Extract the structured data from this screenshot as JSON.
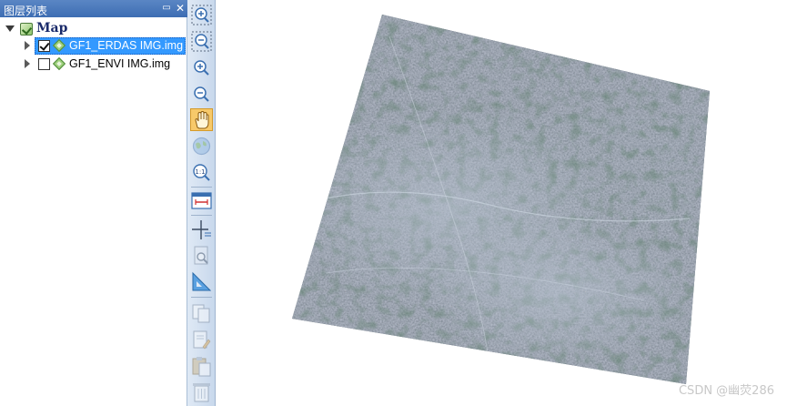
{
  "layer_panel": {
    "title": "图层列表",
    "pin_icon": "pin-icon",
    "close_icon": "close-icon",
    "root": {
      "label": "Map",
      "expanded": true,
      "checked": true,
      "icon": "map-icon"
    },
    "layers": [
      {
        "label": "GF1_ERDAS IMG.img",
        "checked": true,
        "selected": true,
        "icon": "raster-layer-icon"
      },
      {
        "label": "GF1_ENVI IMG.img",
        "checked": false,
        "selected": false,
        "icon": "raster-layer-icon"
      }
    ]
  },
  "toolbar": {
    "tools": [
      {
        "name": "zoom-in-box-tool",
        "icon": "zoom-in-box-icon",
        "active": false
      },
      {
        "name": "zoom-out-box-tool",
        "icon": "zoom-out-box-icon",
        "active": false
      },
      {
        "name": "zoom-in-tool",
        "icon": "zoom-in-icon",
        "active": false
      },
      {
        "name": "zoom-out-tool",
        "icon": "zoom-out-icon",
        "active": false
      },
      {
        "name": "pan-tool",
        "icon": "hand-icon",
        "active": true
      },
      {
        "name": "full-extent-tool",
        "icon": "globe-icon",
        "active": false
      },
      {
        "name": "actual-size-tool",
        "icon": "one-to-one-icon",
        "label": "1:1",
        "active": false
      },
      {
        "name": "measure-tool",
        "icon": "ruler-icon",
        "active": false
      },
      {
        "name": "identify-tool",
        "icon": "crosshair-icon",
        "active": false
      },
      {
        "name": "find-tool",
        "icon": "magnifier-icon",
        "active": false
      },
      {
        "name": "triangle-tool",
        "icon": "triangle-ruler-icon",
        "active": false
      },
      {
        "name": "copy-tool",
        "icon": "copy-icon",
        "active": false
      },
      {
        "name": "edit-tool",
        "icon": "edit-page-icon",
        "active": false
      },
      {
        "name": "paste-tool",
        "icon": "paste-icon",
        "active": false
      },
      {
        "name": "delete-tool",
        "icon": "trash-icon",
        "active": false
      }
    ]
  },
  "map_view": {
    "image_name": "satellite-raster-image",
    "watermark": "CSDN @幽荧286"
  },
  "colors": {
    "panel_header": "#3d6db3",
    "selection": "#3399ff",
    "active_tool": "#f7c96a"
  }
}
